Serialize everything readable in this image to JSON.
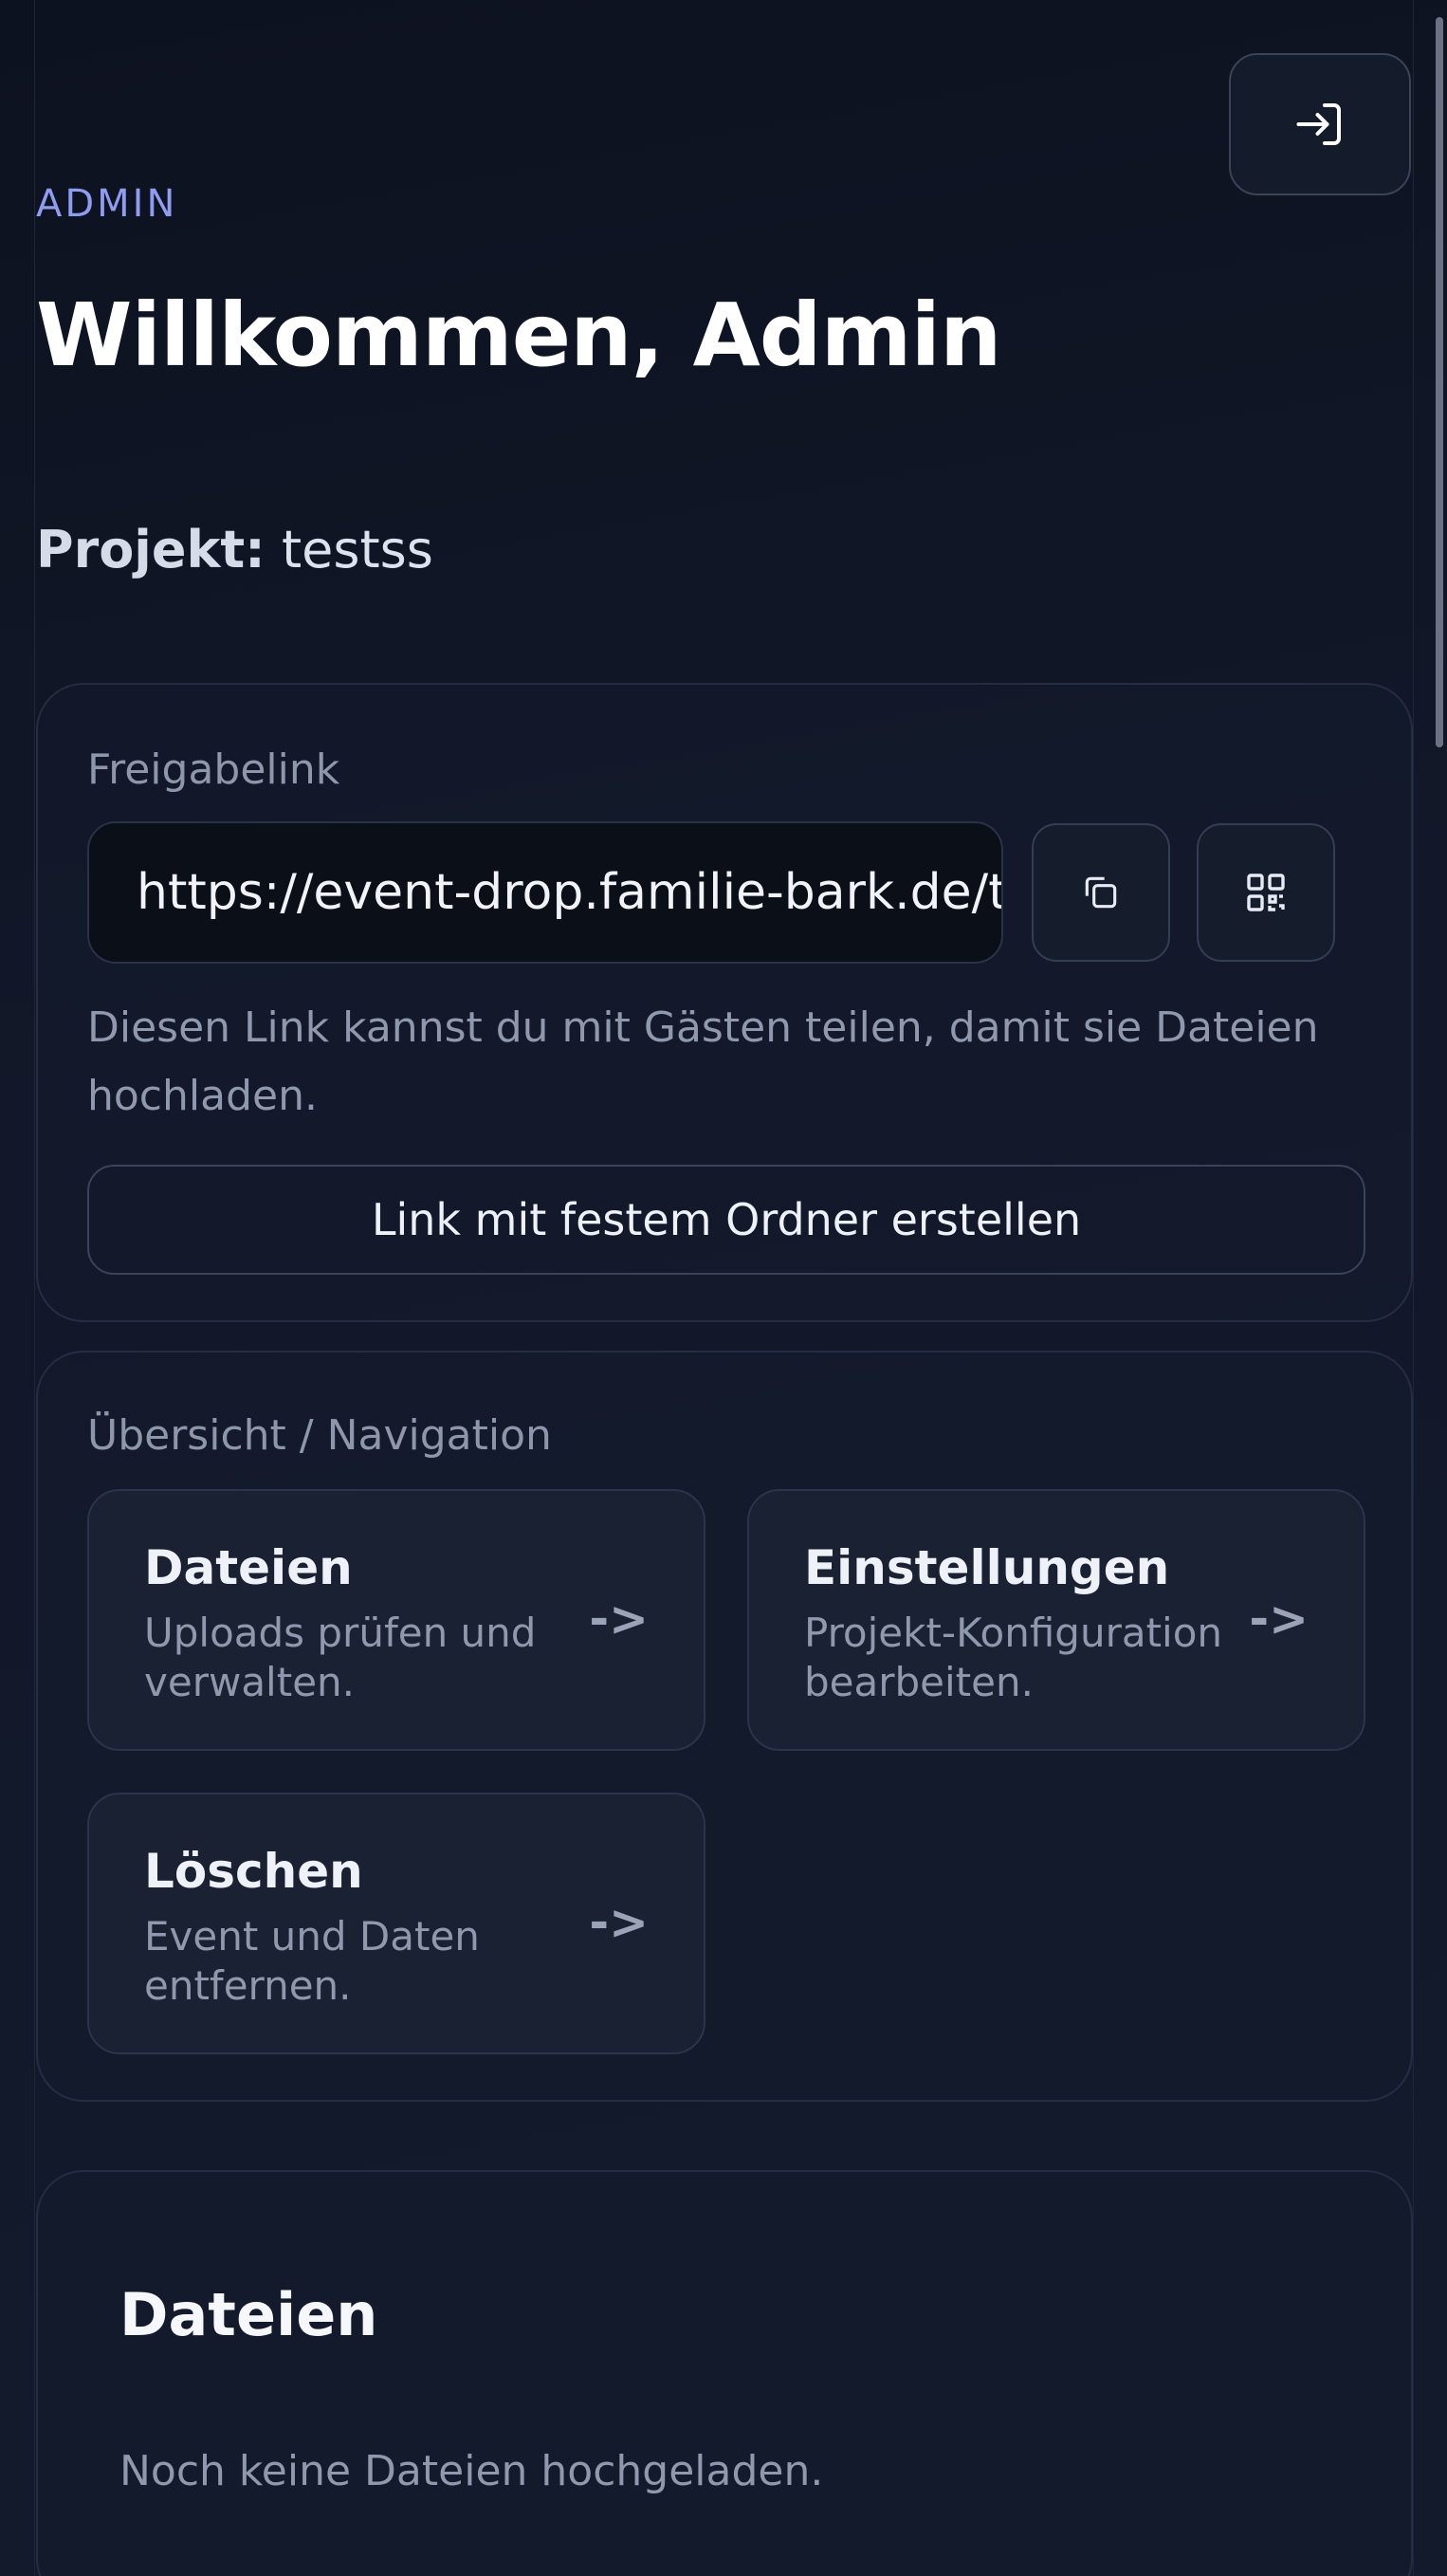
{
  "header": {
    "eyebrow": "ADMIN",
    "title": "Willkommen, Admin",
    "project_label": "Projekt:",
    "project_name": "testss"
  },
  "share": {
    "label": "Freigabelink",
    "url": "https://event-drop.familie-bark.de/testss",
    "hint": "Diesen Link kannst du mit Gästen teilen, damit sie Dateien hochladen.",
    "fixed_folder_button": "Link mit festem Ordner erstellen",
    "copy_icon": "copy-icon",
    "qr_icon": "qr-code-icon"
  },
  "navigation": {
    "label": "Übersicht / Navigation",
    "tiles": [
      {
        "title": "Dateien",
        "description": "Uploads prüfen und verwalten.",
        "arrow": "->"
      },
      {
        "title": "Einstellungen",
        "description": "Projekt-Konfiguration bearbeiten.",
        "arrow": "->"
      },
      {
        "title": "Löschen",
        "description": "Event und Daten entfernen.",
        "arrow": "->"
      }
    ]
  },
  "files": {
    "title": "Dateien",
    "empty_text": "Noch keine Dateien hochgeladen."
  },
  "icons": {
    "logout": "logout-icon"
  },
  "colors": {
    "background": "#0f1422",
    "accent": "#8f9cf0",
    "card_border": "#252d40"
  }
}
